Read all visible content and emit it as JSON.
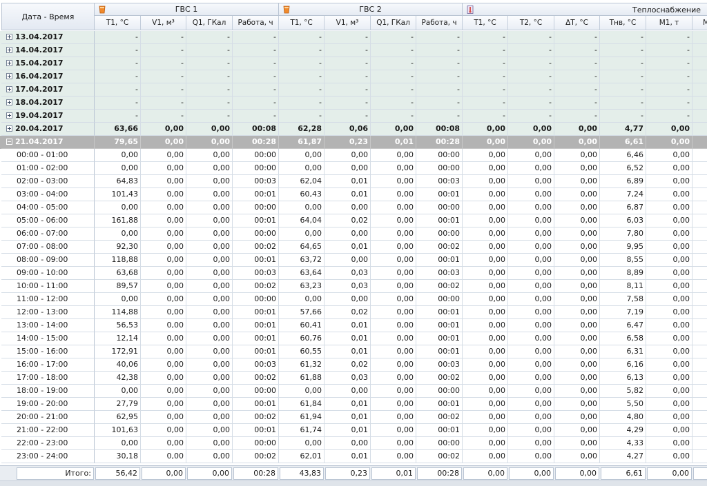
{
  "header": {
    "first_col_label": "Дата - Время",
    "groups": [
      {
        "label": "ГВС 1",
        "icon": "water-heater-icon"
      },
      {
        "label": "ГВС 2",
        "icon": "water-heater-icon"
      },
      {
        "label": "Теплоснабжение",
        "icon": "thermometer-icon"
      }
    ],
    "columns": [
      "T1, °C",
      "V1, м³",
      "Q1, ГКал",
      "Работа, ч",
      "T1, °C",
      "V1, м³",
      "Q1, ГКал",
      "Работа, ч",
      "T1, °C",
      "T2, °C",
      "ΔT, °C",
      "Tнв, °C",
      "M1, т",
      "M"
    ]
  },
  "date_rows": [
    {
      "date": "13.04.2017",
      "values": [
        "-",
        "-",
        "-",
        "-",
        "-",
        "-",
        "-",
        "-",
        "-",
        "-",
        "-",
        "-",
        "-",
        ""
      ]
    },
    {
      "date": "14.04.2017",
      "values": [
        "-",
        "-",
        "-",
        "-",
        "-",
        "-",
        "-",
        "-",
        "-",
        "-",
        "-",
        "-",
        "-",
        ""
      ]
    },
    {
      "date": "15.04.2017",
      "values": [
        "-",
        "-",
        "-",
        "-",
        "-",
        "-",
        "-",
        "-",
        "-",
        "-",
        "-",
        "-",
        "-",
        ""
      ]
    },
    {
      "date": "16.04.2017",
      "values": [
        "-",
        "-",
        "-",
        "-",
        "-",
        "-",
        "-",
        "-",
        "-",
        "-",
        "-",
        "-",
        "-",
        ""
      ]
    },
    {
      "date": "17.04.2017",
      "values": [
        "-",
        "-",
        "-",
        "-",
        "-",
        "-",
        "-",
        "-",
        "-",
        "-",
        "-",
        "-",
        "-",
        ""
      ]
    },
    {
      "date": "18.04.2017",
      "values": [
        "-",
        "-",
        "-",
        "-",
        "-",
        "-",
        "-",
        "-",
        "-",
        "-",
        "-",
        "-",
        "-",
        ""
      ]
    },
    {
      "date": "19.04.2017",
      "values": [
        "-",
        "-",
        "-",
        "-",
        "-",
        "-",
        "-",
        "-",
        "-",
        "-",
        "-",
        "-",
        "-",
        ""
      ]
    },
    {
      "date": "20.04.2017",
      "values": [
        "63,66",
        "0,00",
        "0,00",
        "00:08",
        "62,28",
        "0,06",
        "0,00",
        "00:08",
        "0,00",
        "0,00",
        "0,00",
        "4,77",
        "0,00",
        ""
      ]
    }
  ],
  "selected_row": {
    "date": "21.04.2017",
    "values": [
      "79,65",
      "0,00",
      "0,00",
      "00:28",
      "61,87",
      "0,23",
      "0,01",
      "00:28",
      "0,00",
      "0,00",
      "0,00",
      "6,61",
      "0,00",
      ""
    ]
  },
  "hour_rows": [
    {
      "time": "00:00 - 01:00",
      "values": [
        "0,00",
        "0,00",
        "0,00",
        "00:00",
        "0,00",
        "0,00",
        "0,00",
        "00:00",
        "0,00",
        "0,00",
        "0,00",
        "6,46",
        "0,00",
        ""
      ]
    },
    {
      "time": "01:00 - 02:00",
      "values": [
        "0,00",
        "0,00",
        "0,00",
        "00:00",
        "0,00",
        "0,00",
        "0,00",
        "00:00",
        "0,00",
        "0,00",
        "0,00",
        "6,52",
        "0,00",
        ""
      ]
    },
    {
      "time": "02:00 - 03:00",
      "values": [
        "64,83",
        "0,00",
        "0,00",
        "00:03",
        "62,04",
        "0,01",
        "0,00",
        "00:03",
        "0,00",
        "0,00",
        "0,00",
        "6,89",
        "0,00",
        ""
      ]
    },
    {
      "time": "03:00 - 04:00",
      "values": [
        "101,43",
        "0,00",
        "0,00",
        "00:01",
        "60,43",
        "0,01",
        "0,00",
        "00:01",
        "0,00",
        "0,00",
        "0,00",
        "7,24",
        "0,00",
        ""
      ]
    },
    {
      "time": "04:00 - 05:00",
      "values": [
        "0,00",
        "0,00",
        "0,00",
        "00:00",
        "0,00",
        "0,00",
        "0,00",
        "00:00",
        "0,00",
        "0,00",
        "0,00",
        "6,87",
        "0,00",
        ""
      ]
    },
    {
      "time": "05:00 - 06:00",
      "values": [
        "161,88",
        "0,00",
        "0,00",
        "00:01",
        "64,04",
        "0,02",
        "0,00",
        "00:01",
        "0,00",
        "0,00",
        "0,00",
        "6,03",
        "0,00",
        ""
      ]
    },
    {
      "time": "06:00 - 07:00",
      "values": [
        "0,00",
        "0,00",
        "0,00",
        "00:00",
        "0,00",
        "0,00",
        "0,00",
        "00:00",
        "0,00",
        "0,00",
        "0,00",
        "7,80",
        "0,00",
        ""
      ]
    },
    {
      "time": "07:00 - 08:00",
      "values": [
        "92,30",
        "0,00",
        "0,00",
        "00:02",
        "64,65",
        "0,01",
        "0,00",
        "00:02",
        "0,00",
        "0,00",
        "0,00",
        "9,95",
        "0,00",
        ""
      ]
    },
    {
      "time": "08:00 - 09:00",
      "values": [
        "118,88",
        "0,00",
        "0,00",
        "00:01",
        "63,72",
        "0,00",
        "0,00",
        "00:01",
        "0,00",
        "0,00",
        "0,00",
        "8,55",
        "0,00",
        ""
      ]
    },
    {
      "time": "09:00 - 10:00",
      "values": [
        "63,68",
        "0,00",
        "0,00",
        "00:03",
        "63,64",
        "0,03",
        "0,00",
        "00:03",
        "0,00",
        "0,00",
        "0,00",
        "8,89",
        "0,00",
        ""
      ]
    },
    {
      "time": "10:00 - 11:00",
      "values": [
        "89,57",
        "0,00",
        "0,00",
        "00:02",
        "63,23",
        "0,03",
        "0,00",
        "00:02",
        "0,00",
        "0,00",
        "0,00",
        "8,11",
        "0,00",
        ""
      ]
    },
    {
      "time": "11:00 - 12:00",
      "values": [
        "0,00",
        "0,00",
        "0,00",
        "00:00",
        "0,00",
        "0,00",
        "0,00",
        "00:00",
        "0,00",
        "0,00",
        "0,00",
        "7,58",
        "0,00",
        ""
      ]
    },
    {
      "time": "12:00 - 13:00",
      "values": [
        "114,88",
        "0,00",
        "0,00",
        "00:01",
        "57,66",
        "0,02",
        "0,00",
        "00:01",
        "0,00",
        "0,00",
        "0,00",
        "7,19",
        "0,00",
        ""
      ]
    },
    {
      "time": "13:00 - 14:00",
      "values": [
        "56,53",
        "0,00",
        "0,00",
        "00:01",
        "60,41",
        "0,01",
        "0,00",
        "00:01",
        "0,00",
        "0,00",
        "0,00",
        "6,47",
        "0,00",
        ""
      ]
    },
    {
      "time": "14:00 - 15:00",
      "values": [
        "12,14",
        "0,00",
        "0,00",
        "00:01",
        "60,76",
        "0,01",
        "0,00",
        "00:01",
        "0,00",
        "0,00",
        "0,00",
        "6,58",
        "0,00",
        ""
      ]
    },
    {
      "time": "15:00 - 16:00",
      "values": [
        "172,91",
        "0,00",
        "0,00",
        "00:01",
        "60,55",
        "0,01",
        "0,00",
        "00:01",
        "0,00",
        "0,00",
        "0,00",
        "6,31",
        "0,00",
        ""
      ]
    },
    {
      "time": "16:00 - 17:00",
      "values": [
        "40,06",
        "0,00",
        "0,00",
        "00:03",
        "61,32",
        "0,02",
        "0,00",
        "00:03",
        "0,00",
        "0,00",
        "0,00",
        "6,16",
        "0,00",
        ""
      ]
    },
    {
      "time": "17:00 - 18:00",
      "values": [
        "42,38",
        "0,00",
        "0,00",
        "00:02",
        "61,88",
        "0,03",
        "0,00",
        "00:02",
        "0,00",
        "0,00",
        "0,00",
        "6,13",
        "0,00",
        ""
      ]
    },
    {
      "time": "18:00 - 19:00",
      "values": [
        "0,00",
        "0,00",
        "0,00",
        "00:00",
        "0,00",
        "0,00",
        "0,00",
        "00:00",
        "0,00",
        "0,00",
        "0,00",
        "5,82",
        "0,00",
        ""
      ]
    },
    {
      "time": "19:00 - 20:00",
      "values": [
        "27,79",
        "0,00",
        "0,00",
        "00:01",
        "61,84",
        "0,01",
        "0,00",
        "00:01",
        "0,00",
        "0,00",
        "0,00",
        "5,50",
        "0,00",
        ""
      ]
    },
    {
      "time": "20:00 - 21:00",
      "values": [
        "62,95",
        "0,00",
        "0,00",
        "00:02",
        "61,94",
        "0,01",
        "0,00",
        "00:02",
        "0,00",
        "0,00",
        "0,00",
        "4,80",
        "0,00",
        ""
      ]
    },
    {
      "time": "21:00 - 22:00",
      "values": [
        "101,63",
        "0,00",
        "0,00",
        "00:01",
        "61,74",
        "0,01",
        "0,00",
        "00:01",
        "0,00",
        "0,00",
        "0,00",
        "4,29",
        "0,00",
        ""
      ]
    },
    {
      "time": "22:00 - 23:00",
      "values": [
        "0,00",
        "0,00",
        "0,00",
        "00:00",
        "0,00",
        "0,00",
        "0,00",
        "00:00",
        "0,00",
        "0,00",
        "0,00",
        "4,33",
        "0,00",
        ""
      ]
    },
    {
      "time": "23:00 - 24:00",
      "values": [
        "30,18",
        "0,00",
        "0,00",
        "00:02",
        "62,01",
        "0,01",
        "0,00",
        "00:02",
        "0,00",
        "0,00",
        "0,00",
        "4,27",
        "0,00",
        ""
      ]
    }
  ],
  "totals": {
    "label": "Итого:",
    "values": [
      "56,42",
      "0,00",
      "0,00",
      "00:28",
      "43,83",
      "0,23",
      "0,01",
      "00:28",
      "0,00",
      "0,00",
      "0,00",
      "6,61",
      "0,00",
      ""
    ]
  },
  "colors": {
    "date_row_bg": "#e4eeea",
    "selected_row_bg": "#b3b3b3",
    "header_bg": "#e6ebf3",
    "grid_line": "#d5dde6"
  }
}
